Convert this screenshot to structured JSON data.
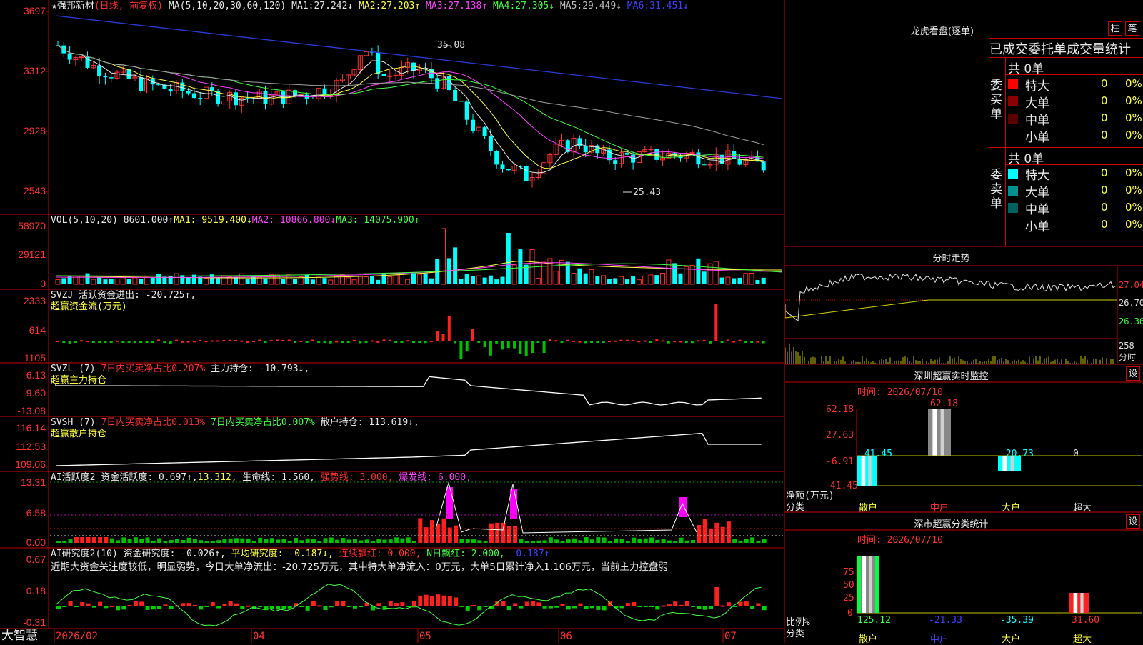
{
  "stock": {
    "name": "★强邦新材",
    "period": "(日线, 前复权)",
    "ma_header": "MA(5,10,20,30,60,120)",
    "ma": [
      {
        "label": "MA1:",
        "value": "27.242↓",
        "color": "#e8e8e8"
      },
      {
        "label": "MA2:",
        "value": "27.203↑",
        "color": "#ffff40"
      },
      {
        "label": "MA3:",
        "value": "27.138↑",
        "color": "#ff40ff"
      },
      {
        "label": "MA4:",
        "value": "27.305↓",
        "color": "#40ff40"
      },
      {
        "label": "MA5:",
        "value": "29.449↓",
        "color": "#c0c0c0"
      },
      {
        "label": "MA6:",
        "value": "31.451↓",
        "color": "#4040ff"
      }
    ],
    "high_mark": "35.08",
    "low_mark": "25.43",
    "price_axis": [
      "3697",
      "3312",
      "2928",
      "2543"
    ]
  },
  "vol": {
    "header": "VOL(5,10,20)",
    "value": "8601.000↑",
    "ma1": "MA1: 9519.400↓",
    "ma2": "MA2: 10866.800↓",
    "ma3": "MA3: 14075.900↑",
    "axis": [
      "58970",
      "29121",
      "0"
    ]
  },
  "svzj": {
    "header": "SVZJ  活跃资金进出: -20.725↑,",
    "sub": "超赢资金流(万元)",
    "axis": [
      "2333",
      "614",
      "-1105"
    ]
  },
  "svzl": {
    "header": "SVZL (7)",
    "h2": "7日内买卖净占比0.207%",
    "h3": "主力持仓: -10.793↓,",
    "sub": "超赢主力持仓",
    "axis": [
      "-6.13",
      "-9.60",
      "-13.08"
    ]
  },
  "svsh": {
    "header": "SVSH (7)",
    "h2": "7日内买卖净占比0.013%",
    "h3": "7日内买卖净占比0.007%",
    "h4": "散户持仓: 113.619↓,",
    "sub": "超赢散户持仓",
    "axis": [
      "116.14",
      "112.53",
      "109.06"
    ]
  },
  "ai1": {
    "header": "AI活跃度2",
    "h2": "资金活跃度: 0.697↑,",
    "h3": "13.312,",
    "h4": "生命线: 1.560,",
    "h5": "强势线: 3.000,",
    "h6": "爆发线: 6.000,",
    "axis": [
      "13.31",
      "6.58",
      "0.00"
    ]
  },
  "ai2": {
    "header": "AI研究度2(10)",
    "h2": "资金研究度: -0.026↑,",
    "h3": "平均研究度: -0.187↓,",
    "h4": "连续飘红: 0.000,",
    "h5": "N日飘红: 2.000,",
    "h6": "-0.187↑",
    "comment": "近期大资金关注度较低，明显弱势，今日大单净流出：-20.725万元，其中特大单净流入：0万元，大单5日累计净入1.106万元，当前主力控盘弱",
    "axis": [
      "0.67",
      "0.18",
      "-0.31"
    ]
  },
  "bottom": {
    "brand": "大智慧",
    "dates": [
      "2026/02",
      "04",
      "05",
      "06",
      "07"
    ]
  },
  "dragon": {
    "title": "龙虎看盘(逐单)",
    "btn1": "柱",
    "btn2": "笔",
    "tabline": "已成交委托单成交量统计",
    "buy_label": "委买单",
    "sell_label": "委卖单",
    "buy_total": "共 0单",
    "sell_total": "共 0单",
    "buy_rows": [
      {
        "name": "特大",
        "qty": "0",
        "pct": "0%",
        "color": "#ff0000"
      },
      {
        "name": "大单",
        "qty": "0",
        "pct": "0%",
        "color": "#8b0000"
      },
      {
        "name": "中单",
        "qty": "0",
        "pct": "0%",
        "color": "#5a0000"
      },
      {
        "name": "小单",
        "qty": "0",
        "pct": "0%",
        "color": "#000000"
      }
    ],
    "sell_rows": [
      {
        "name": "特大",
        "qty": "0",
        "pct": "0%",
        "color": "#00ffff"
      },
      {
        "name": "大单",
        "qty": "0",
        "pct": "0%",
        "color": "#009090"
      },
      {
        "name": "中单",
        "qty": "0",
        "pct": "0%",
        "color": "#006060"
      },
      {
        "name": "小单",
        "qty": "0",
        "pct": "0%",
        "color": "#000000"
      }
    ]
  },
  "intraday": {
    "title": "分时走势",
    "axis": [
      "27.04",
      "26.70",
      "26.36"
    ],
    "vol_top": "258",
    "vol_label": "分时"
  },
  "monitor": {
    "title": "深圳超赢实时监控",
    "btn": "设",
    "time": "时间: 2026/07/10",
    "axis": [
      "62.18",
      "27.63",
      "-6.91",
      "-41.45"
    ],
    "ylabel": "净额(万元)",
    "xlabel": "分类",
    "cats": [
      "散户",
      "中户",
      "大户",
      "超大"
    ],
    "values": [
      "-41.45",
      "62.18",
      "-20.73",
      "0"
    ]
  },
  "classify": {
    "title": "深市超赢分类统计",
    "btn": "设",
    "time": "时间: 2026/07/10",
    "axis": [
      "75",
      "50",
      "25",
      "0"
    ],
    "ylabel": "比例%",
    "xlabel": "分类",
    "cats": [
      "散户",
      "中户",
      "大户",
      "超大"
    ],
    "values": [
      "125.12",
      "-21.33",
      "-35.39",
      "31.60"
    ]
  },
  "chart_data": [
    {
      "type": "candlestick",
      "title": "强邦新材 日线",
      "ylim": [
        25.43,
        36.97
      ],
      "annotations": [
        {
          "label": "35.08",
          "kind": "high"
        },
        {
          "label": "25.43",
          "kind": "low"
        }
      ],
      "x": [
        "2026/02",
        "04",
        "05",
        "06",
        "07"
      ]
    },
    {
      "type": "bar",
      "title": "深圳超赢实时监控",
      "categories": [
        "散户",
        "中户",
        "大户",
        "超大"
      ],
      "values": [
        -41.45,
        62.18,
        -20.73,
        0
      ],
      "ylabel": "净额(万元)",
      "ylim": [
        -41.45,
        62.18
      ]
    },
    {
      "type": "bar",
      "title": "深市超赢分类统计",
      "categories": [
        "散户",
        "中户",
        "大户",
        "超大"
      ],
      "values": [
        125.12,
        -21.33,
        -35.39,
        31.6
      ],
      "ylabel": "比例%",
      "ylim": [
        0,
        75
      ]
    }
  ]
}
